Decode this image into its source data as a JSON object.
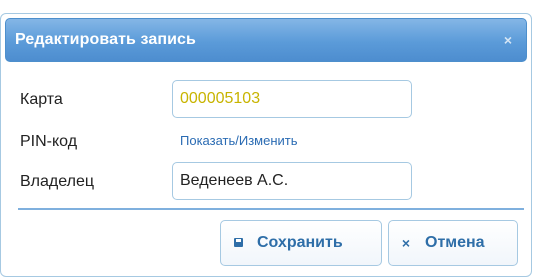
{
  "dialog": {
    "title": "Редактировать запись",
    "close_icon": "×"
  },
  "fields": {
    "card_label": "Карта",
    "card_value": "000005103",
    "card_value_color": "#c8b400",
    "pin_label": "PIN-код",
    "pin_link": "Показать/Изменить",
    "owner_label": "Владелец",
    "owner_value": "Веденеев А.С."
  },
  "buttons": {
    "save_label": "Сохранить",
    "save_icon": "floppy-disk-icon",
    "cancel_label": "Отмена",
    "cancel_icon": "×"
  },
  "colors": {
    "titlebar": "#5b9bd9",
    "accent": "#2e6ea8",
    "border": "#a6c9e2"
  }
}
